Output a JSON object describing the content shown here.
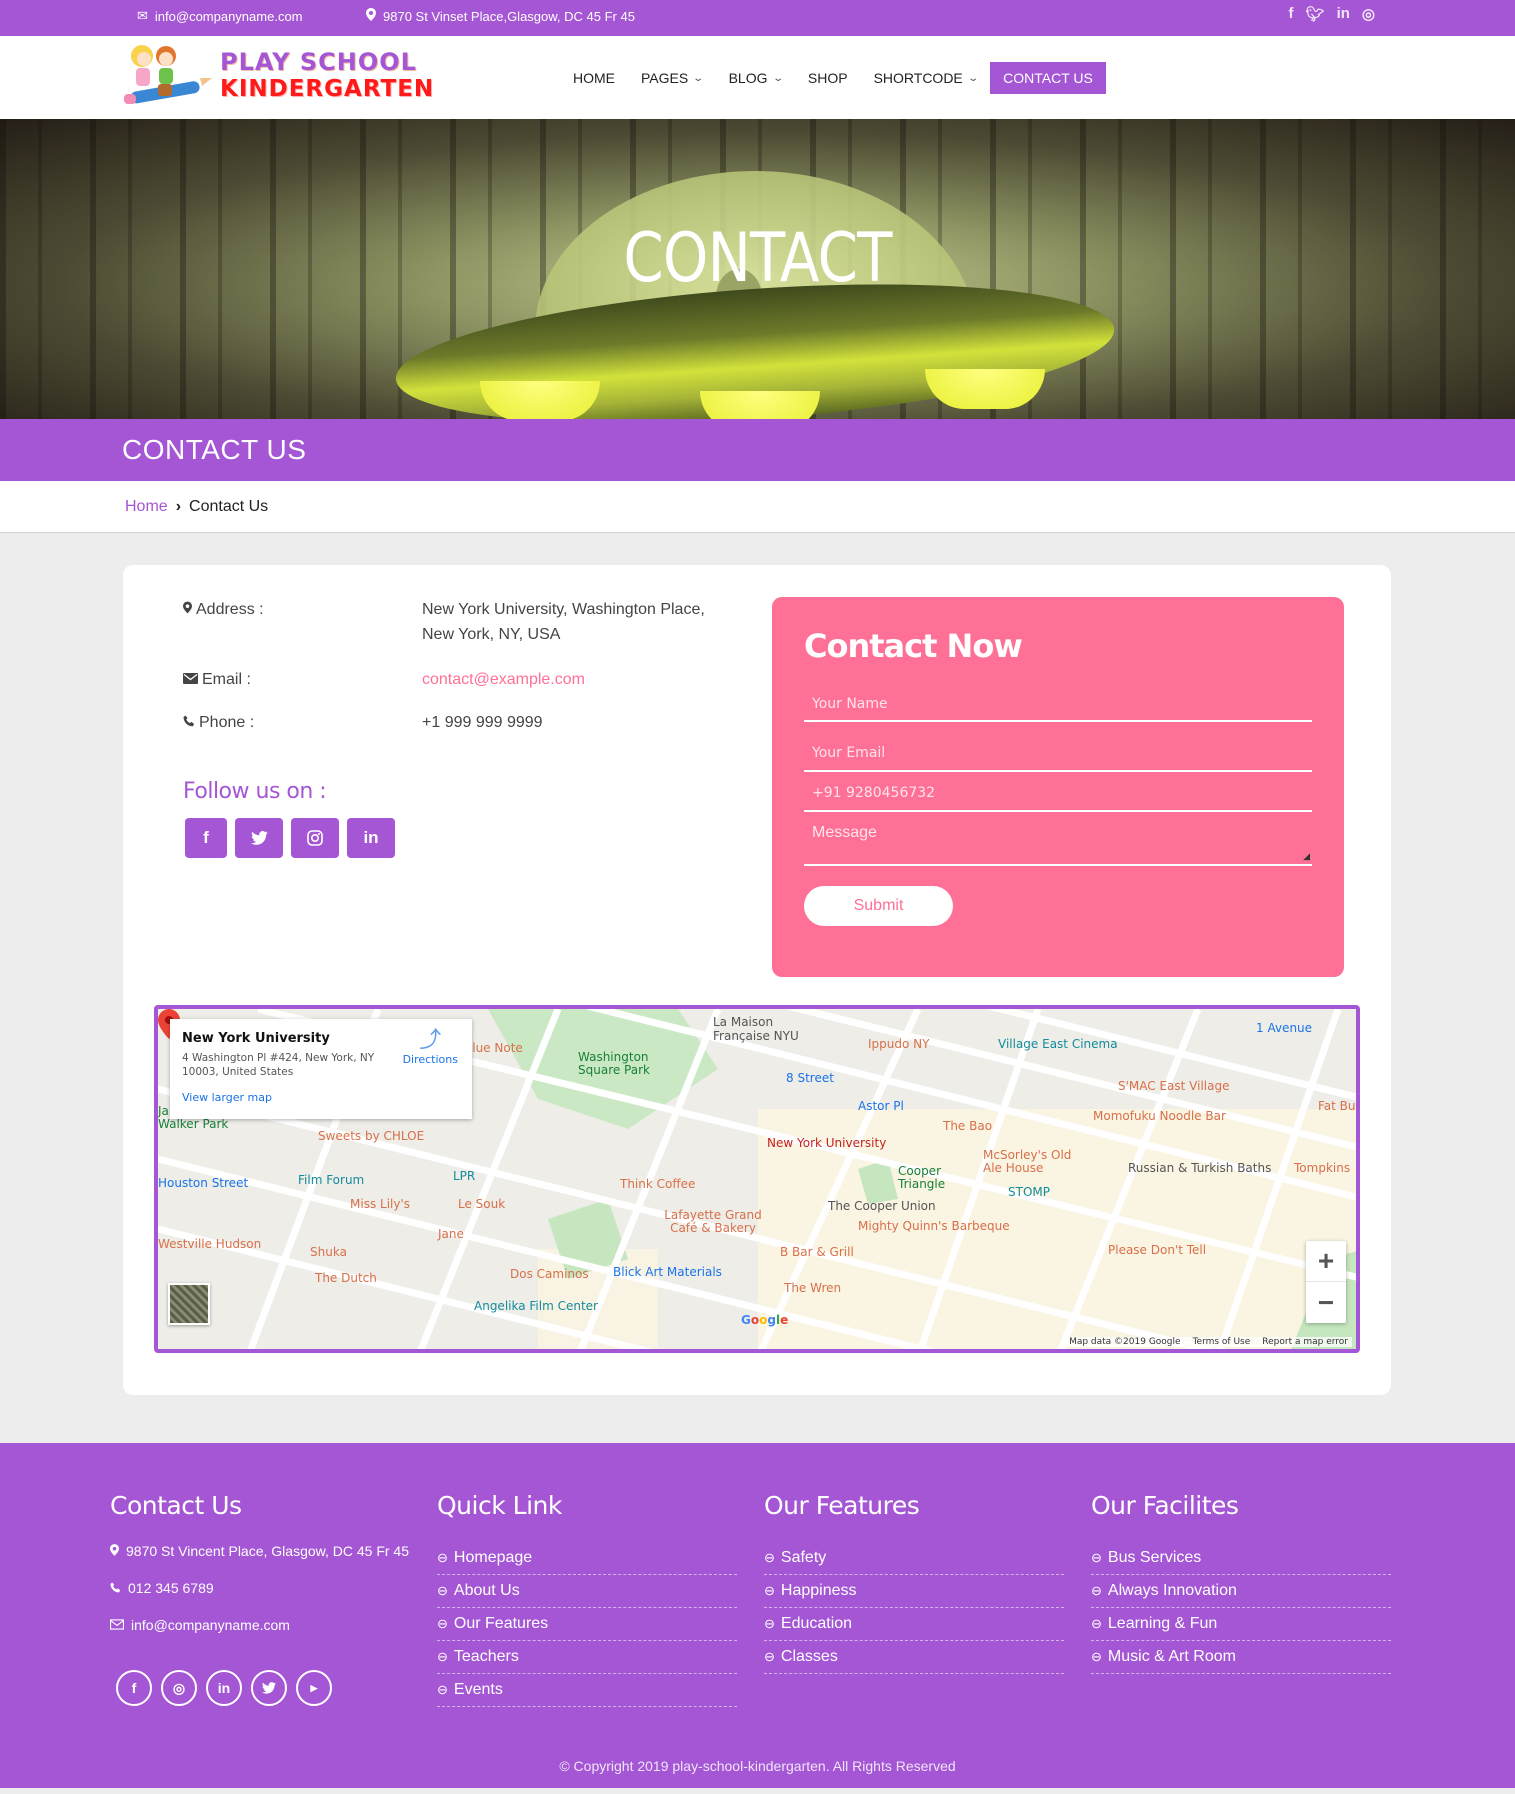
{
  "topbar": {
    "email": "info@companyname.com",
    "address": "9870 St Vinset Place,Glasgow, DC 45 Fr 45",
    "social": [
      "facebook",
      "twitter",
      "linkedin",
      "instagram"
    ]
  },
  "logo": {
    "line1": "PLAY SCHOOL",
    "line2": "KINDERGARTEN"
  },
  "nav": {
    "items": [
      {
        "label": "HOME",
        "dropdown": false
      },
      {
        "label": "PAGES",
        "dropdown": true
      },
      {
        "label": "BLOG",
        "dropdown": true
      },
      {
        "label": "SHOP",
        "dropdown": false
      },
      {
        "label": "SHORTCODE",
        "dropdown": true
      },
      {
        "label": "CONTACT US",
        "dropdown": false,
        "active": true
      }
    ]
  },
  "hero": {
    "title": "CONTACT"
  },
  "page_band": {
    "title": "CONTACT US"
  },
  "breadcrumb": {
    "home": "Home",
    "separator": "›",
    "current": "Contact Us"
  },
  "contact_info": {
    "address_label": "Address :",
    "address_value_line1": "New York University, Washington Place,",
    "address_value_line2": "New York, NY, USA",
    "email_label": "Email :",
    "email_value": "contact@example.com",
    "phone_label": "Phone :",
    "phone_value": "+1 999 999 9999",
    "follow_title": "Follow us on :",
    "follow_icons": [
      "facebook",
      "twitter",
      "instagram",
      "linkedin"
    ]
  },
  "contact_form": {
    "title": "Contact Now",
    "name_placeholder": "Your Name",
    "email_placeholder": "Your Email",
    "phone_placeholder": "+91 9280456732",
    "message_placeholder": "Message",
    "submit_label": "Submit"
  },
  "map": {
    "place_title": "New York University",
    "place_address": "4 Washington Pl #424, New York, NY 10003, United States",
    "directions_label": "Directions",
    "view_larger": "View larger map",
    "pin_label": "New York University",
    "labels": {
      "blue_note": "Blue Note",
      "wsp": "Washington Square Park",
      "la_maison": "La Maison Française NYU",
      "ippudo": "Ippudo NY",
      "village_east": "Village East Cinema",
      "first_ave": "1 Avenue",
      "eighth_st": "8 Street",
      "astor": "Astor Pl",
      "smac": "S'MAC East Village",
      "fat_bud": "Fat Bud",
      "james_walker": "James J Walker Park",
      "sweets": "Sweets by CHLOE",
      "the_bao": "The Bao",
      "momofuku": "Momofuku Noodle Bar",
      "mcsorleys": "McSorley's Old Ale House",
      "houston": "Houston Street",
      "film_forum": "Film Forum",
      "lpr": "LPR",
      "think_coffee": "Think Coffee",
      "cooper_triangle": "Cooper Triangle",
      "russian_baths": "Russian & Turkish Baths",
      "tompkins": "Tompkins",
      "stomp": "STOMP",
      "miss_lilys": "Miss Lily's",
      "le_souk": "Le Souk",
      "cooper_union": "The Cooper Union",
      "lafayette": "Lafayette Grand Café & Bakery",
      "mighty_quinns": "Mighty Quinn's Barbeque",
      "jane": "Jane",
      "westville": "Westville Hudson",
      "shuka": "Shuka",
      "b_bar": "B Bar & Grill",
      "please_dont_tell": "Please Don't Tell",
      "the_dutch": "The Dutch",
      "dos_caminos": "Dos Caminos",
      "blick": "Blick Art Materials",
      "the_wren": "The Wren",
      "angelika": "Angelika Film Center",
      "google": "Google"
    },
    "attribution": [
      "Map data ©2019 Google",
      "Terms of Use",
      "Report a map error"
    ]
  },
  "footer": {
    "contact": {
      "title": "Contact Us",
      "address": "9870 St Vincent Place, Glasgow, DC 45 Fr 45",
      "phone": "012 345 6789",
      "email": "info@companyname.com",
      "social": [
        "facebook",
        "instagram",
        "linkedin",
        "twitter",
        "youtube"
      ]
    },
    "quick_link": {
      "title": "Quick Link",
      "items": [
        "Homepage",
        "About Us",
        "Our Features",
        "Teachers",
        "Events"
      ]
    },
    "features": {
      "title": "Our Features",
      "items": [
        "Safety",
        "Happiness",
        "Education",
        "Classes"
      ]
    },
    "facilities": {
      "title": "Our Facilites",
      "items": [
        "Bus Services",
        "Always Innovation",
        "Learning & Fun",
        "Music & Art Room"
      ]
    },
    "copyright": "© Copyright 2019 play-school-kindergarten. All Rights Reserved"
  },
  "colors": {
    "primary": "#a556d4",
    "pink": "#ff7096",
    "background": "#ededed"
  }
}
